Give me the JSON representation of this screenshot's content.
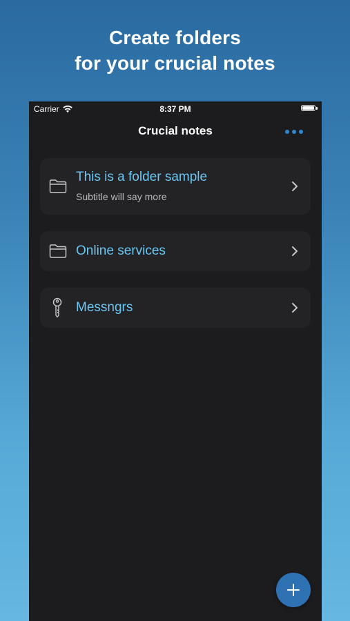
{
  "promo": {
    "line1": "Create folders",
    "line2": "for your crucial notes"
  },
  "status_bar": {
    "carrier": "Carrier",
    "time": "8:37 PM"
  },
  "navbar": {
    "title": "Crucial notes",
    "more_icon": "ellipsis-icon"
  },
  "folders": [
    {
      "title": "This is a folder sample",
      "subtitle": "Subtitle will say more",
      "icon": "folder-icon"
    },
    {
      "title": "Online services",
      "icon": "folder-icon"
    },
    {
      "title": "Messngrs",
      "icon": "key-icon"
    }
  ],
  "fab": {
    "icon": "plus-icon"
  },
  "colors": {
    "accent": "#6cc6f2",
    "fab": "#2f72b3",
    "background": "#1c1c1e",
    "cell": "#232326"
  }
}
